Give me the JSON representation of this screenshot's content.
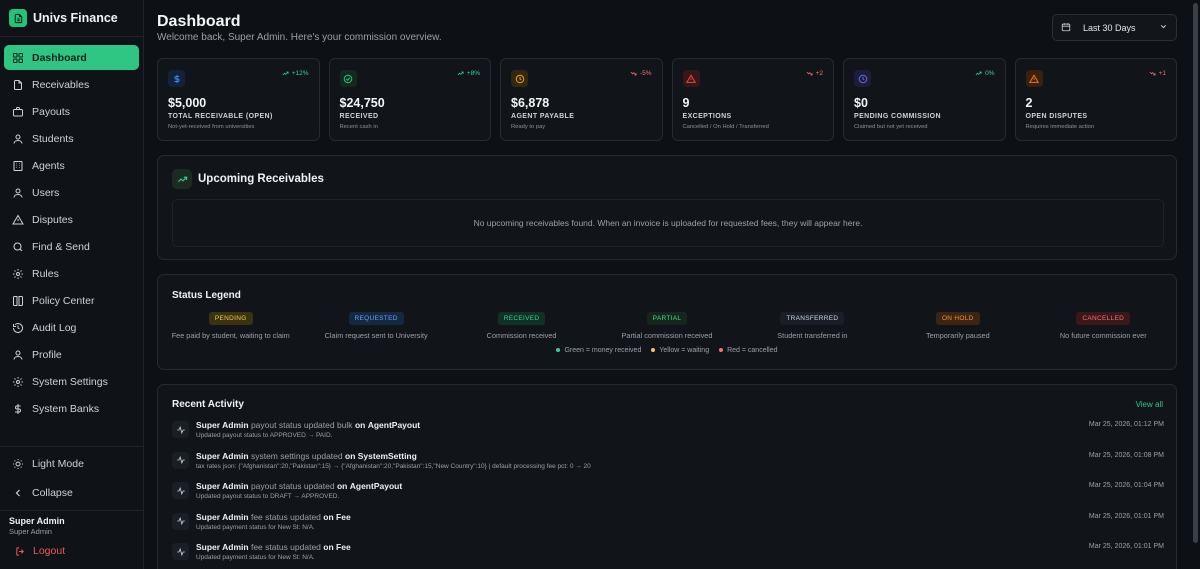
{
  "brand": {
    "name": "Univs Finance",
    "icon": "document-icon",
    "color": "#22c47a"
  },
  "sidebar": {
    "items": [
      {
        "label": "Dashboard",
        "icon": "dashboard-icon",
        "active": true
      },
      {
        "label": "Receivables",
        "icon": "document-icon"
      },
      {
        "label": "Payouts",
        "icon": "briefcase-icon"
      },
      {
        "label": "Students",
        "icon": "user-icon"
      },
      {
        "label": "Agents",
        "icon": "building-icon"
      },
      {
        "label": "Users",
        "icon": "user-icon"
      },
      {
        "label": "Disputes",
        "icon": "warning-icon"
      },
      {
        "label": "Find & Send",
        "icon": "search-icon"
      },
      {
        "label": "Rules",
        "icon": "gear-icon"
      },
      {
        "label": "Policy Center",
        "icon": "book-icon"
      },
      {
        "label": "Audit Log",
        "icon": "history-icon"
      },
      {
        "label": "Profile",
        "icon": "user-icon"
      },
      {
        "label": "System Settings",
        "icon": "gear-icon"
      },
      {
        "label": "System Banks",
        "icon": "dollar-icon"
      }
    ],
    "light_mode": "Light Mode",
    "collapse": "Collapse",
    "user": {
      "name": "Super Admin",
      "role": "Super Admin"
    },
    "logout": "Logout"
  },
  "header": {
    "title": "Dashboard",
    "subtitle": "Welcome back, Super Admin. Here's your commission overview.",
    "range": "Last 30 Days"
  },
  "cards": [
    {
      "value": "$5,000",
      "label": "TOTAL RECEIVABLE (OPEN)",
      "sub": "Not-yet-received from universities",
      "trend": "+12%",
      "trend_dir": "up",
      "icon": "dollar-icon",
      "color": "#3b82f6"
    },
    {
      "value": "$24,750",
      "label": "RECEIVED",
      "sub": "Recent cash in",
      "trend": "+8%",
      "trend_dir": "up",
      "icon": "check-circle-icon",
      "color": "#22c47a"
    },
    {
      "value": "$6,878",
      "label": "AGENT PAYABLE",
      "sub": "Ready to pay",
      "trend": "-5%",
      "trend_dir": "down",
      "icon": "clock-icon",
      "color": "#f59e0b"
    },
    {
      "value": "9",
      "label": "EXCEPTIONS",
      "sub": "Cancelled / On Hold / Transferred",
      "trend": "+2",
      "trend_dir": "down",
      "icon": "warning-icon",
      "color": "#ef4444"
    },
    {
      "value": "$0",
      "label": "PENDING COMMISSION",
      "sub": "Claimed but not yet received",
      "trend": "0%",
      "trend_dir": "up",
      "icon": "clock-icon",
      "color": "#6366f1"
    },
    {
      "value": "2",
      "label": "OPEN DISPUTES",
      "sub": "Requires immediate action",
      "trend": "+1",
      "trend_dir": "down",
      "icon": "warning-icon",
      "color": "#f97316"
    }
  ],
  "upcoming": {
    "title": "Upcoming Receivables",
    "empty": "No upcoming receivables found. When an invoice is uploaded for requested fees, they will appear here."
  },
  "legend": {
    "title": "Status Legend",
    "items": [
      {
        "badge": "PENDING",
        "desc": "Fee paid by student, waiting to claim",
        "bg": "#3b3212",
        "fg": "#f2c94c"
      },
      {
        "badge": "REQUESTED",
        "desc": "Claim request sent to University",
        "bg": "#16283f",
        "fg": "#60a5fa"
      },
      {
        "badge": "RECEIVED",
        "desc": "Commission received",
        "bg": "#123024",
        "fg": "#34d399"
      },
      {
        "badge": "PARTIAL",
        "desc": "Partial commission received",
        "bg": "#15271d",
        "fg": "#4ade80"
      },
      {
        "badge": "TRANSFERRED",
        "desc": "Student transferred in",
        "bg": "#1a1f27",
        "fg": "#cbd5e1"
      },
      {
        "badge": "ON HOLD",
        "desc": "Temporarily paused",
        "bg": "#3a2512",
        "fg": "#fb923c"
      },
      {
        "badge": "CANCELLED",
        "desc": "No future commission ever",
        "bg": "#3a1719",
        "fg": "#f87171"
      }
    ],
    "key": [
      {
        "label": "Green = money received",
        "color": "#34d399"
      },
      {
        "label": "Yellow = waiting",
        "color": "#f2c94c"
      },
      {
        "label": "Red = cancelled",
        "color": "#f87171"
      }
    ]
  },
  "activity": {
    "title": "Recent Activity",
    "view_all": "View all",
    "rows": [
      {
        "actor": "Super Admin",
        "action": "payout status updated bulk",
        "on": "on",
        "target": "AgentPayout",
        "detail": "Updated payout status to APPROVED → PAID.",
        "time": "Mar 25, 2026, 01:12 PM"
      },
      {
        "actor": "Super Admin",
        "action": "system settings updated",
        "on": "on",
        "target": "SystemSetting",
        "detail": "tax rates json: {\"Afghanistan\":20,\"Pakistan\":15} → {\"Afghanistan\":20,\"Pakistan\":15,\"New Country\":10} | default processing fee pct: 0 → 20",
        "time": "Mar 25, 2026, 01:08 PM"
      },
      {
        "actor": "Super Admin",
        "action": "payout status updated",
        "on": "on",
        "target": "AgentPayout",
        "detail": "Updated payout status to DRAFT → APPROVED.",
        "time": "Mar 25, 2026, 01:04 PM"
      },
      {
        "actor": "Super Admin",
        "action": "fee status updated",
        "on": "on",
        "target": "Fee",
        "detail": "Updated payment status for New St: N/A.",
        "time": "Mar 25, 2026, 01:01 PM"
      },
      {
        "actor": "Super Admin",
        "action": "fee status updated",
        "on": "on",
        "target": "Fee",
        "detail": "Updated payment status for New St: N/A.",
        "time": "Mar 25, 2026, 01:01 PM"
      }
    ]
  }
}
